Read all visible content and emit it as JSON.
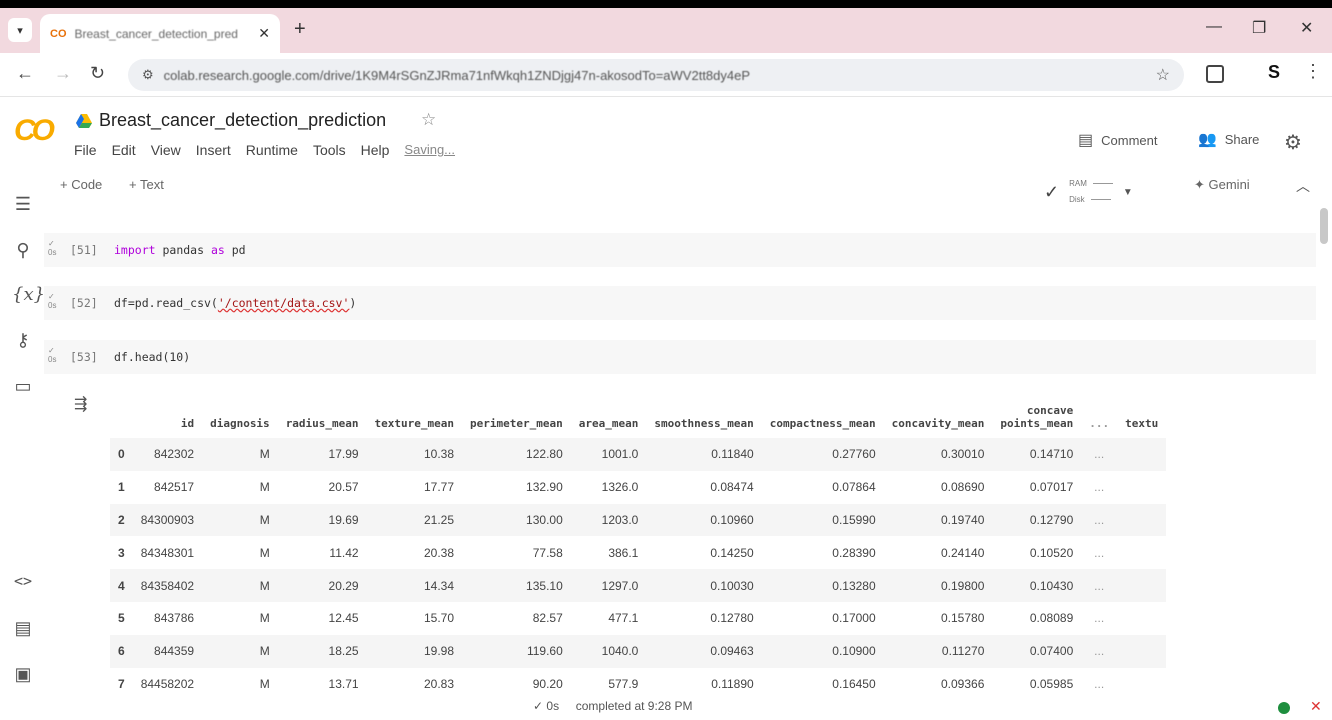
{
  "browser": {
    "tab_title": "Breast_cancer_detection_pred",
    "tab_favicon": "CO",
    "url": "colab.research.google.com/drive/1K9M4rSGnZJRma71nfWkqh1ZNDjgj47n-akosodTo=aWV2tt8dy4eP"
  },
  "colab": {
    "logo": "CO",
    "title": "Breast_cancer_detection_prediction",
    "menu": [
      "File",
      "Edit",
      "View",
      "Insert",
      "Runtime",
      "Tools",
      "Help"
    ],
    "saving": "Saving...",
    "comment": "Comment",
    "share": "Share",
    "add_code": "+ Code",
    "add_text": "+ Text",
    "ram_label": "RAM",
    "disk_label": "Disk",
    "gemini": "Gemini"
  },
  "cells": [
    {
      "num": "[51]",
      "code": [
        {
          "t": "import",
          "k": "kw"
        },
        {
          "t": " pandas ",
          "k": ""
        },
        {
          "t": "as",
          "k": "kw"
        },
        {
          "t": " pd",
          "k": ""
        }
      ]
    },
    {
      "num": "[52]",
      "code": [
        {
          "t": "df=pd.read_csv(",
          "k": ""
        },
        {
          "t": "'/content/data.csv'",
          "k": "str"
        },
        {
          "t": ")",
          "k": ""
        }
      ]
    },
    {
      "num": "[53]",
      "code": [
        {
          "t": "df.head(10)",
          "k": ""
        }
      ]
    }
  ],
  "table": {
    "columns": [
      "",
      "id",
      "diagnosis",
      "radius_mean",
      "texture_mean",
      "perimeter_mean",
      "area_mean",
      "smoothness_mean",
      "compactness_mean",
      "concavity_mean",
      "concave points_mean",
      "...",
      "textu"
    ],
    "rows": [
      [
        "0",
        "842302",
        "M",
        "17.99",
        "10.38",
        "122.80",
        "1001.0",
        "0.11840",
        "0.27760",
        "0.30010",
        "0.14710",
        "..."
      ],
      [
        "1",
        "842517",
        "M",
        "20.57",
        "17.77",
        "132.90",
        "1326.0",
        "0.08474",
        "0.07864",
        "0.08690",
        "0.07017",
        "..."
      ],
      [
        "2",
        "84300903",
        "M",
        "19.69",
        "21.25",
        "130.00",
        "1203.0",
        "0.10960",
        "0.15990",
        "0.19740",
        "0.12790",
        "..."
      ],
      [
        "3",
        "84348301",
        "M",
        "11.42",
        "20.38",
        "77.58",
        "386.1",
        "0.14250",
        "0.28390",
        "0.24140",
        "0.10520",
        "..."
      ],
      [
        "4",
        "84358402",
        "M",
        "20.29",
        "14.34",
        "135.10",
        "1297.0",
        "0.10030",
        "0.13280",
        "0.19800",
        "0.10430",
        "..."
      ],
      [
        "5",
        "843786",
        "M",
        "12.45",
        "15.70",
        "82.57",
        "477.1",
        "0.12780",
        "0.17000",
        "0.15780",
        "0.08089",
        "..."
      ],
      [
        "6",
        "844359",
        "M",
        "18.25",
        "19.98",
        "119.60",
        "1040.0",
        "0.09463",
        "0.10900",
        "0.11270",
        "0.07400",
        "..."
      ],
      [
        "7",
        "84458202",
        "M",
        "13.71",
        "20.83",
        "90.20",
        "577.9",
        "0.11890",
        "0.16450",
        "0.09366",
        "0.05985",
        "..."
      ]
    ]
  },
  "status": {
    "elapsed": "0s",
    "text": "completed at 9:28 PM"
  }
}
